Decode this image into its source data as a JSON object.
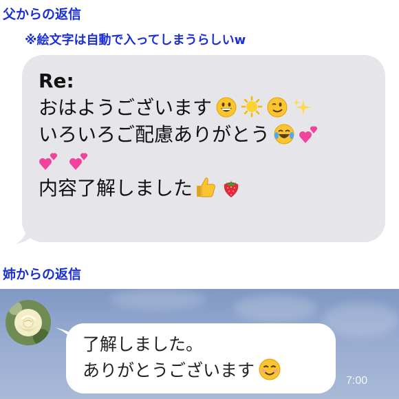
{
  "father": {
    "heading": "父からの返信",
    "note": "※絵文字は自動で入ってしまうらしいw",
    "message": {
      "line1": "Re:",
      "line2": "おはようございます",
      "line3": " いろいろご配慮ありがとう",
      "line5": "内容了解しました"
    }
  },
  "sister": {
    "heading": "姉からの返信",
    "message": {
      "line1": "了解しました。",
      "line2": "ありがとうございます"
    },
    "timestamp": "7:00"
  },
  "icons": [
    "grinning-face",
    "sun",
    "winking-face",
    "sparkles",
    "tears-of-joy-face",
    "two-hearts",
    "thumbs-up",
    "strawberry",
    "smiling-face"
  ],
  "colors": {
    "heading": "#1a2fd6",
    "gray_bubble": "#e5e5ea",
    "chat_background": "#97abd0",
    "white_bubble": "#ffffff"
  }
}
